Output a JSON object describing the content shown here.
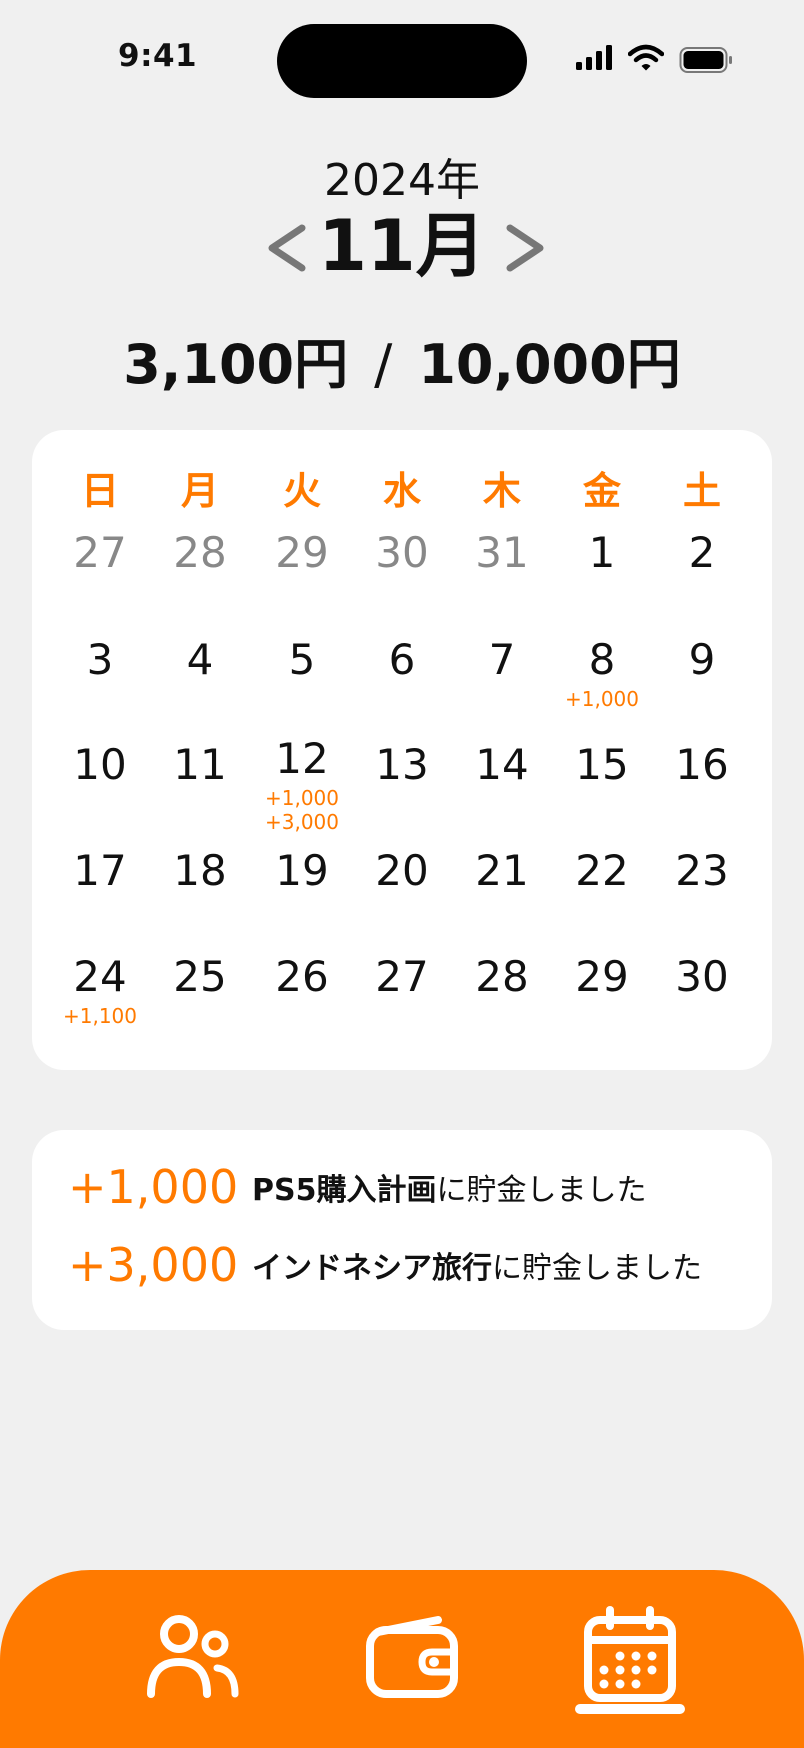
{
  "status_bar": {
    "time": "9:41"
  },
  "header": {
    "year": "2024年",
    "month": "11月",
    "prev_label": "<",
    "next_label": ">"
  },
  "progress": {
    "saved": "3,100円",
    "separator": "/",
    "goal": "10,000円"
  },
  "calendar": {
    "weekdays": [
      "日",
      "月",
      "火",
      "水",
      "木",
      "金",
      "土"
    ],
    "weeks": [
      [
        {
          "d": "27",
          "dim": true
        },
        {
          "d": "28",
          "dim": true
        },
        {
          "d": "29",
          "dim": true
        },
        {
          "d": "30",
          "dim": true
        },
        {
          "d": "31",
          "dim": true
        },
        {
          "d": "1"
        },
        {
          "d": "2"
        }
      ],
      [
        {
          "d": "3"
        },
        {
          "d": "4"
        },
        {
          "d": "5"
        },
        {
          "d": "6"
        },
        {
          "d": "7"
        },
        {
          "d": "8",
          "amounts": [
            "+1,000"
          ]
        },
        {
          "d": "9"
        }
      ],
      [
        {
          "d": "10"
        },
        {
          "d": "11"
        },
        {
          "d": "12",
          "amounts": [
            "+1,000",
            "+3,000"
          ]
        },
        {
          "d": "13"
        },
        {
          "d": "14"
        },
        {
          "d": "15"
        },
        {
          "d": "16"
        }
      ],
      [
        {
          "d": "17"
        },
        {
          "d": "18"
        },
        {
          "d": "19"
        },
        {
          "d": "20"
        },
        {
          "d": "21"
        },
        {
          "d": "22"
        },
        {
          "d": "23"
        }
      ],
      [
        {
          "d": "24",
          "amounts": [
            "+1,100"
          ]
        },
        {
          "d": "25"
        },
        {
          "d": "26"
        },
        {
          "d": "27"
        },
        {
          "d": "28"
        },
        {
          "d": "29"
        },
        {
          "d": "30"
        }
      ]
    ]
  },
  "deposits": [
    {
      "amount": "+1,000",
      "goal": "PS5購入計画",
      "suffix": "に貯金しました"
    },
    {
      "amount": "+3,000",
      "goal": "インドネシア旅行",
      "suffix": "に貯金しました"
    }
  ],
  "nav": {
    "items": [
      {
        "icon": "users-icon"
      },
      {
        "icon": "wallet-icon"
      },
      {
        "icon": "calendar-icon",
        "active": true
      }
    ]
  },
  "colors": {
    "accent": "#ff7a00",
    "background": "#f0f0f0",
    "card": "#ffffff",
    "dim_text": "#888888"
  }
}
